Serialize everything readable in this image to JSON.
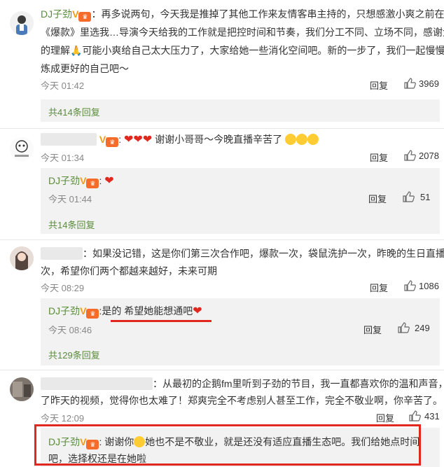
{
  "c1": {
    "name": "DJ子劲",
    "line1": "：再多说两句，今天我是推掉了其他工作来友情客串主持的，只想感激小爽之前在",
    "line2": "《爆款》里选我…导演今天给我的工作就是把控时间和节奏，我们分工不同、立场不同，感谢大家",
    "line3a": "的理解",
    "line3b": "可能小爽给自己太大压力了，大家给她一些消化空间吧。新的一步了，我们一起慢慢修",
    "line4": "炼成更好的自己吧～",
    "time": "今天 01:42",
    "reply": "回复",
    "likes": "3969",
    "more": "共414条回复"
  },
  "c2": {
    "tail": "谢谢小哥哥～今晚直播辛苦了",
    "time": "今天 01:34",
    "reply": "回复",
    "likes": "2078",
    "sub_name": "DJ子劲",
    "sub_time": "今天 01:44",
    "sub_reply": "回复",
    "sub_likes": "51",
    "more": "共14条回复"
  },
  "c3": {
    "line1": "：如果没记错，这是你们第三次合作吧，爆款一次，袋鼠洗护一次，昨晚的生日直播一",
    "line2": "次，希望你们两个都越来越好，未来可期",
    "time": "今天 08:29",
    "reply": "回复",
    "likes": "1086",
    "sub_name": "DJ子劲",
    "sub_text": "是的 希望她能想通吧",
    "sub_time": "今天 08:46",
    "sub_reply": "回复",
    "sub_likes": "249",
    "more": "共129条回复"
  },
  "c4": {
    "line1": "：从最初的企鹅fm里听到子劲的节目，我一直都喜欢你的温和声音，看",
    "line2": "了昨天的视频，觉得你也太难了！郑爽完全不考虑别人甚至工作，完全不敬业啊，你辛苦了。",
    "time": "今天 12:09",
    "reply": "回复",
    "likes": "431",
    "sub_name": "DJ子劲",
    "sub_line1a": "谢谢你",
    "sub_line1b": "她也不是不敬业，就是还没有适应直播生态吧。我们给她点时间",
    "sub_line2": "吧，选择权还是在她啦"
  }
}
